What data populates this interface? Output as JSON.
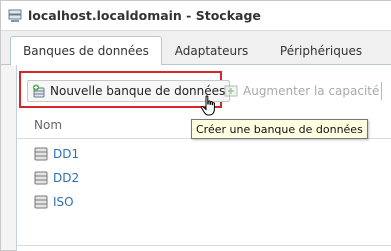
{
  "window": {
    "title": "localhost.localdomain - Stockage",
    "title_icon": "server-icon"
  },
  "tabs": [
    {
      "label": "Banques de données",
      "active": true
    },
    {
      "label": "Adaptateurs",
      "active": false
    },
    {
      "label": "Périphériques",
      "active": false
    }
  ],
  "toolbar": {
    "new_datastore_label": "Nouvelle banque de données",
    "new_datastore_icon": "add-datastore-icon",
    "increase_capacity_label": "Augmenter la capacité",
    "increase_capacity_icon": "increase-capacity-icon",
    "highlight_color": "#d6262a"
  },
  "tooltip": {
    "text": "Créer une banque de données"
  },
  "table": {
    "columns": [
      "Nom"
    ],
    "rows": [
      {
        "name": "DD1",
        "icon": "datastore-icon"
      },
      {
        "name": "DD2",
        "icon": "datastore-icon"
      },
      {
        "name": "ISO",
        "icon": "datastore-icon"
      }
    ]
  },
  "colors": {
    "link": "#2f6fb3",
    "tab_border": "#b9c6d4",
    "tooltip_bg": "#ffffe1"
  }
}
